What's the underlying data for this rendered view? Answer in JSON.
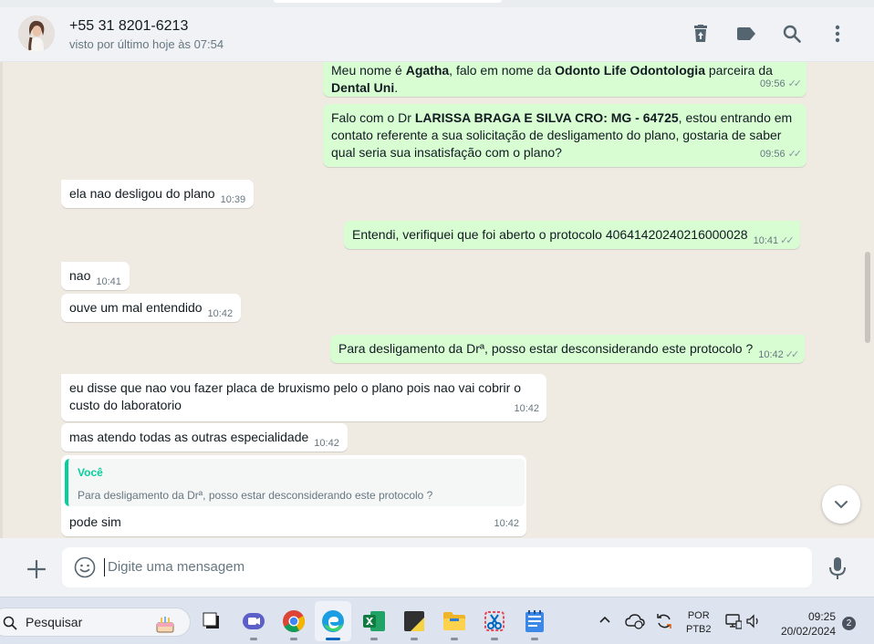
{
  "header": {
    "contact_name": "+55 31 8201-6213",
    "status": "visto por último hoje às 07:54",
    "icons": [
      "delete-icon",
      "label-icon",
      "search-icon",
      "menu-icon"
    ]
  },
  "messages": [
    {
      "dir": "out",
      "parts": [
        "Meu nome é ",
        "Agatha",
        ", falo em nome da ",
        "Odonto Life Odontologia",
        " parceira da ",
        "Dental Uni",
        "."
      ],
      "time": "09:56"
    },
    {
      "dir": "out",
      "parts": [
        "Falo com o  Dr ",
        "LARISSA BRAGA E SILVA CRO:  MG - 64725",
        ", estou entrando em contato referente a sua solicitação de desligamento do plano, gostaria de saber qual seria sua insatisfação com o plano?"
      ],
      "time": "09:56"
    },
    {
      "dir": "in",
      "text": "ela nao desligou do plano",
      "time": "10:39"
    },
    {
      "dir": "out",
      "text": "Entendi, verifiquei que foi aberto o protocolo 40641420240216000028",
      "time": "10:41"
    },
    {
      "dir": "in",
      "text": "nao",
      "time": "10:41"
    },
    {
      "dir": "in",
      "text": "ouve um mal entendido",
      "time": "10:42"
    },
    {
      "dir": "out",
      "text": "Para desligamento da Drª, posso estar desconsiderando este protocolo ?",
      "time": "10:42"
    },
    {
      "dir": "in",
      "text": "eu disse que nao vou fazer placa de bruxismo pelo o plano pois nao vai cobrir o custo do laboratorio",
      "time": "10:42"
    },
    {
      "dir": "in",
      "text": "mas atendo todas as outras especialidade",
      "time": "10:42"
    },
    {
      "dir": "in",
      "quote": {
        "author": "Você",
        "text": "Para desligamento da Drª, posso estar desconsiderando este protocolo ?"
      },
      "text": "pode sim",
      "time": "10:42"
    }
  ],
  "composer": {
    "placeholder": "Digite uma mensagem"
  },
  "taskbar": {
    "search_label": "Pesquisar",
    "apps": [
      "task-view",
      "teams",
      "chrome",
      "edge",
      "excel",
      "sticky-notes",
      "file-explorer",
      "snipping-tool",
      "notepad"
    ],
    "language": "POR",
    "keyboard": "PTB2",
    "time": "09:25",
    "date": "20/02/2024",
    "notifications": "2"
  }
}
